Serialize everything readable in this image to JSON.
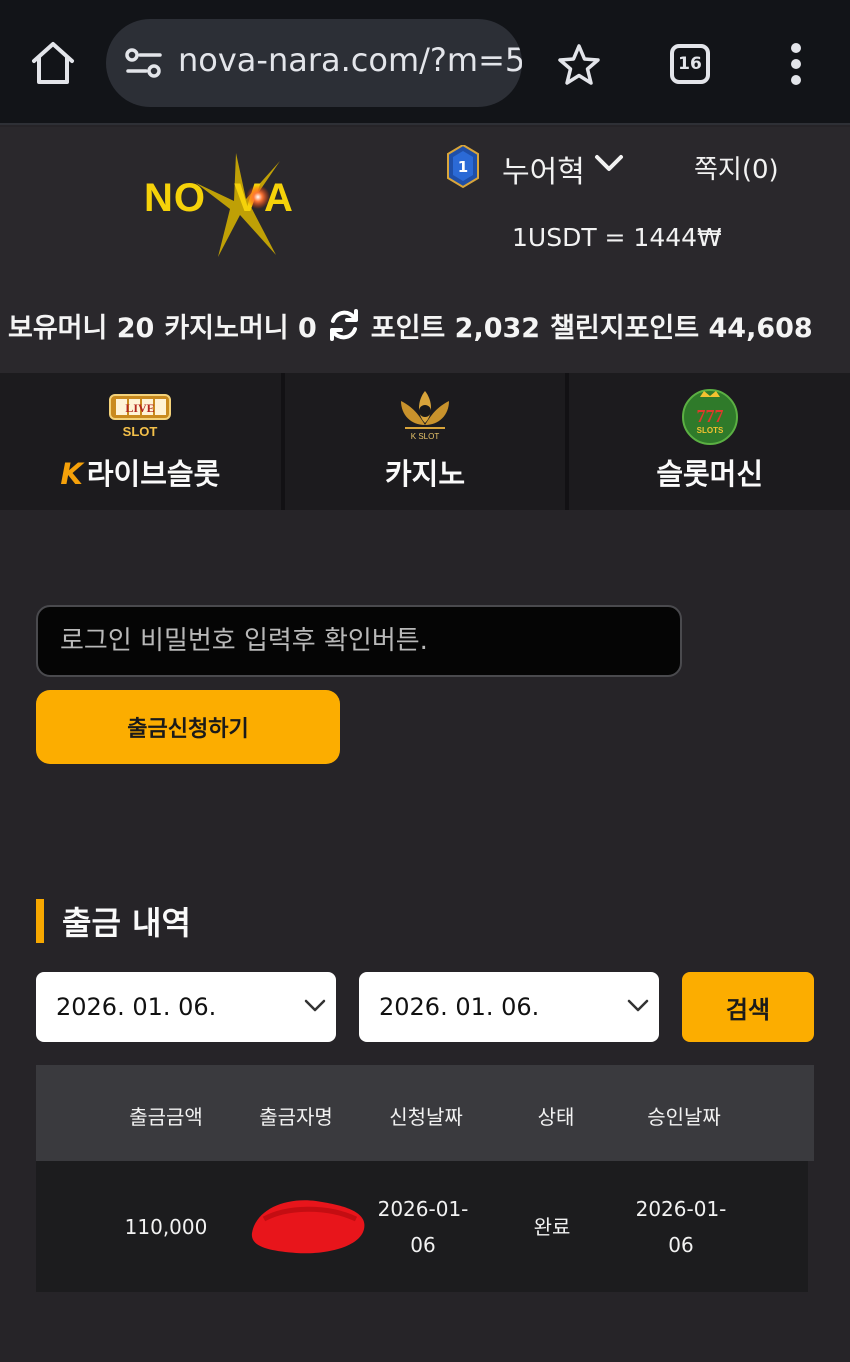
{
  "browser": {
    "url": "nova-nara.com/?m=5",
    "tab_count": "16"
  },
  "header": {
    "logo_text": "NOVA",
    "rank_level": "1",
    "username": "누어혁",
    "messages": "쪽지(0)",
    "exchange_rate": "1USDT = 1444₩"
  },
  "balances": {
    "held_money": "보유머니 20",
    "casino_money": "카지노머니 0",
    "points": "포인트 2,032",
    "challenge_points": "챌린지포인트 44,608"
  },
  "game_tabs": [
    {
      "label": "라이브슬롯",
      "icon_text": "LIVE SLOT",
      "prefix": "K"
    },
    {
      "label": "카지노",
      "icon_text": "K SLOT"
    },
    {
      "label": "슬롯머신",
      "icon_text": "777 SLOTS"
    }
  ],
  "withdraw": {
    "password_placeholder": "로그인 비밀번호 입력후 확인버튼.",
    "submit_label": "출금신청하기"
  },
  "history": {
    "title": "출금 내역",
    "start_date": "2026. 01. 06.",
    "end_date": "2026. 01. 06.",
    "search_label": "검색",
    "columns": [
      "출금금액",
      "출금자명",
      "신청날짜",
      "상태",
      "승인날짜"
    ],
    "rows": [
      {
        "amount": "110,000",
        "name": "",
        "request_date_line1": "2026-01-",
        "request_date_line2": "06",
        "status": "완료",
        "approve_date_line1": "2026-01-",
        "approve_date_line2": "06"
      }
    ]
  },
  "colors": {
    "accent": "#fcad00",
    "background": "#262428",
    "header": "#2a282c"
  }
}
